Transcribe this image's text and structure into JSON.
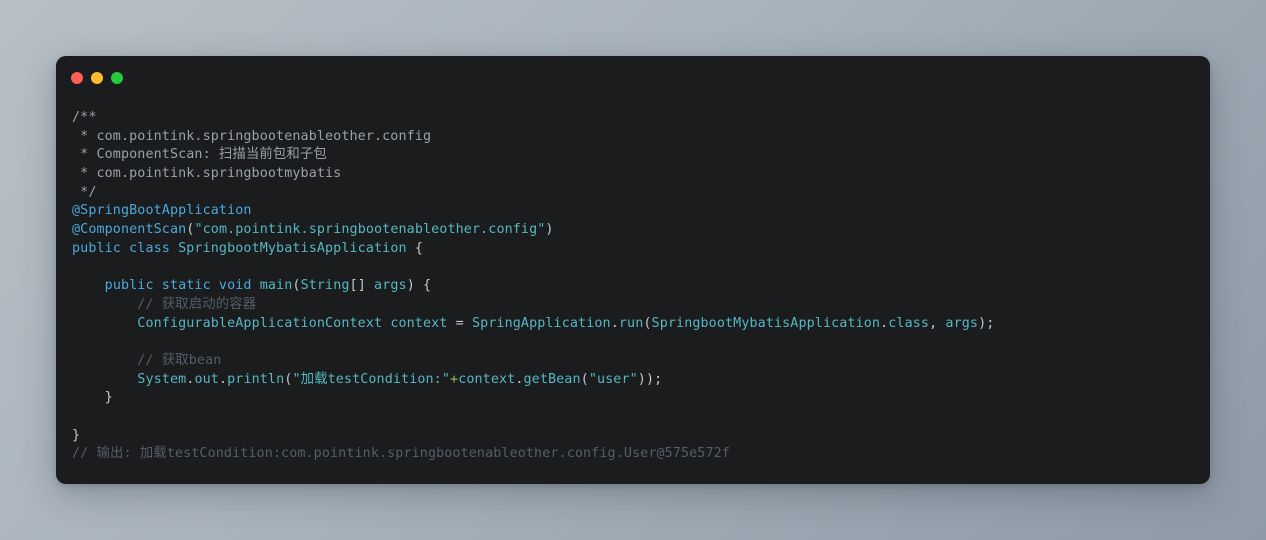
{
  "window": {
    "title": "",
    "traffic_lights": [
      {
        "name": "close-button",
        "color": "#ff5f57"
      },
      {
        "name": "minimize-button",
        "color": "#febc2e"
      },
      {
        "name": "maximize-button",
        "color": "#28c840"
      }
    ],
    "background_color": "#1a1c1e"
  },
  "page": {
    "background_color": "#a9b3bc"
  },
  "code": {
    "language": "java",
    "lines": [
      {
        "n": 1,
        "text": "/**"
      },
      {
        "n": 2,
        "text": " * com.pointink.springbootenableother.config"
      },
      {
        "n": 3,
        "text": " * ComponentScan: 扫描当前包和子包"
      },
      {
        "n": 4,
        "text": " * com.pointink.springbootmybatis"
      },
      {
        "n": 5,
        "text": " */"
      },
      {
        "n": 6,
        "text": "@SpringBootApplication"
      },
      {
        "n": 7,
        "text": "@ComponentScan(\"com.pointink.springbootenableother.config\")"
      },
      {
        "n": 8,
        "text": "public class SpringbootMybatisApplication {"
      },
      {
        "n": 9,
        "text": ""
      },
      {
        "n": 10,
        "text": "    public static void main(String[] args) {"
      },
      {
        "n": 11,
        "text": "        // 获取启动的容器"
      },
      {
        "n": 12,
        "text": "        ConfigurableApplicationContext context = SpringApplication.run(SpringbootMybatisApplication.class, args);"
      },
      {
        "n": 13,
        "text": ""
      },
      {
        "n": 14,
        "text": "        // 获取bean"
      },
      {
        "n": 15,
        "text": "        System.out.println(\"加载testCondition:\"+context.getBean(\"user\"));"
      },
      {
        "n": 16,
        "text": "    }"
      },
      {
        "n": 17,
        "text": ""
      },
      {
        "n": 18,
        "text": "}"
      },
      {
        "n": 19,
        "text": "// 输出: 加载testCondition:com.pointink.springbootenableother.config.User@575e572f"
      }
    ],
    "tokens": {
      "doc_comment_color": "#9ba1a8",
      "line_comment_color": "#555e68",
      "keyword_color": "#4ca8da",
      "identifier_color": "#56b6c2",
      "string_color": "#56b6c2",
      "operator_color": "#8cc265",
      "punctuation_color": "#c3c8cd"
    },
    "segments": [
      [
        {
          "c": "doc",
          "t": "/**"
        }
      ],
      [
        {
          "c": "doc",
          "t": " * com.pointink.springbootenableother.config"
        }
      ],
      [
        {
          "c": "doc",
          "t": " * ComponentScan: 扫描当前包和子包"
        }
      ],
      [
        {
          "c": "doc",
          "t": " * com.pointink.springbootmybatis"
        }
      ],
      [
        {
          "c": "doc",
          "t": " */"
        }
      ],
      [
        {
          "c": "ann",
          "t": "@SpringBootApplication"
        }
      ],
      [
        {
          "c": "ann",
          "t": "@ComponentScan"
        },
        {
          "c": "pun",
          "t": "("
        },
        {
          "c": "str",
          "t": "\"com.pointink.springbootenableother.config\""
        },
        {
          "c": "pun",
          "t": ")"
        }
      ],
      [
        {
          "c": "kw",
          "t": "public class "
        },
        {
          "c": "id",
          "t": "SpringbootMybatisApplication"
        },
        {
          "c": "pun",
          "t": " {"
        }
      ],
      [
        {
          "c": "pun",
          "t": ""
        }
      ],
      [
        {
          "c": "pun",
          "t": "    "
        },
        {
          "c": "kw",
          "t": "public static void "
        },
        {
          "c": "id",
          "t": "main"
        },
        {
          "c": "pun",
          "t": "("
        },
        {
          "c": "id",
          "t": "String"
        },
        {
          "c": "pun",
          "t": "[] "
        },
        {
          "c": "id",
          "t": "args"
        },
        {
          "c": "pun",
          "t": ") {"
        }
      ],
      [
        {
          "c": "pun",
          "t": "        "
        },
        {
          "c": "cmt",
          "t": "// 获取启动的容器"
        }
      ],
      [
        {
          "c": "pun",
          "t": "        "
        },
        {
          "c": "id",
          "t": "ConfigurableApplicationContext context "
        },
        {
          "c": "pun",
          "t": "= "
        },
        {
          "c": "id",
          "t": "SpringApplication"
        },
        {
          "c": "pun",
          "t": "."
        },
        {
          "c": "id",
          "t": "run"
        },
        {
          "c": "pun",
          "t": "("
        },
        {
          "c": "id",
          "t": "SpringbootMybatisApplication"
        },
        {
          "c": "pun",
          "t": "."
        },
        {
          "c": "id",
          "t": "class"
        },
        {
          "c": "pun",
          "t": ", "
        },
        {
          "c": "id",
          "t": "args"
        },
        {
          "c": "pun",
          "t": ");"
        }
      ],
      [
        {
          "c": "pun",
          "t": ""
        }
      ],
      [
        {
          "c": "pun",
          "t": "        "
        },
        {
          "c": "cmt",
          "t": "// 获取bean"
        }
      ],
      [
        {
          "c": "pun",
          "t": "        "
        },
        {
          "c": "id",
          "t": "System"
        },
        {
          "c": "pun",
          "t": "."
        },
        {
          "c": "id",
          "t": "out"
        },
        {
          "c": "pun",
          "t": "."
        },
        {
          "c": "id",
          "t": "println"
        },
        {
          "c": "pun",
          "t": "("
        },
        {
          "c": "str",
          "t": "\"加载testCondition:\""
        },
        {
          "c": "op",
          "t": "+"
        },
        {
          "c": "id",
          "t": "context"
        },
        {
          "c": "pun",
          "t": "."
        },
        {
          "c": "id",
          "t": "getBean"
        },
        {
          "c": "pun",
          "t": "("
        },
        {
          "c": "str",
          "t": "\"user\""
        },
        {
          "c": "pun",
          "t": "));"
        }
      ],
      [
        {
          "c": "pun",
          "t": "    }"
        }
      ],
      [
        {
          "c": "pun",
          "t": ""
        }
      ],
      [
        {
          "c": "pun",
          "t": "}"
        }
      ],
      [
        {
          "c": "cmt",
          "t": "// 输出: 加载testCondition:com.pointink.springbootenableother.config.User@575e572f"
        }
      ]
    ]
  }
}
